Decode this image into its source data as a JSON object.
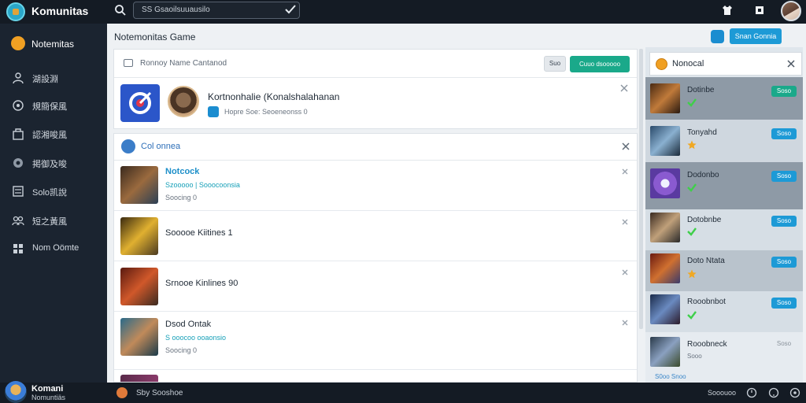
{
  "topbar": {
    "app_title": "Komunitas",
    "search_text": "SS Gsaoilsuuausilo"
  },
  "sidebar": {
    "header_label": "Notemitas",
    "items": [
      {
        "label": "湖設淵",
        "icon": "person-icon"
      },
      {
        "label": "規簡保風",
        "icon": "settings-icon"
      },
      {
        "label": "認湘唆風",
        "icon": "bag-icon"
      },
      {
        "label": "掲御及唆",
        "icon": "chat-icon"
      },
      {
        "label": "Solo凯說",
        "icon": "list-icon"
      },
      {
        "label": "短之黃風",
        "icon": "group-icon"
      },
      {
        "label": "Nom Oömte",
        "icon": "grid-icon"
      }
    ]
  },
  "main": {
    "title": "Notemonitas Game",
    "blue_button": "Snan Gonnia"
  },
  "panel1": {
    "prompt": "Ronnoy  Name Cantanod",
    "small_button": "Suo",
    "green_button": "Cuuo dsooooo",
    "name": "Kortnonhalie (Konalshalahanan",
    "sub": "Hopre Soe:    Seoeneonss    0"
  },
  "panel2": {
    "header": "Col onnea",
    "rows": [
      {
        "title": "Notcock",
        "meta1": "Szooooo  | Sooocoonsia",
        "meta2": "Soocing    0"
      },
      {
        "title": "Sooooe Kiitines  1",
        "meta1": "",
        "meta2": ""
      },
      {
        "title": "Srnooe Kinlines  90",
        "meta1": "",
        "meta2": ""
      },
      {
        "title": "Dsod Ontak",
        "meta1": "S ooocoo  ooaonsio",
        "meta2": "Soocing    0"
      }
    ]
  },
  "rpanel": {
    "header": "Nonocal",
    "rows": [
      {
        "name": "Dotinbe",
        "badge": "Soso",
        "badge_color": "#1aa98a",
        "mark": "check"
      },
      {
        "name": "Tonyahd",
        "badge": "Soso",
        "badge_color": "#1d9ad6",
        "mark": "star"
      },
      {
        "name": "Dodonbo",
        "badge": "Soso",
        "badge_color": "#1d9ad6",
        "mark": "check"
      },
      {
        "name": "Dotobnbe",
        "badge": "Soso",
        "badge_color": "#1d9ad6",
        "mark": "check"
      },
      {
        "name": "Doto Ntata",
        "badge": "Soso",
        "badge_color": "#1d9ad6",
        "mark": "star"
      },
      {
        "name": "Rooobnbot",
        "badge": "Soso",
        "badge_color": "#1d9ad6",
        "mark": "check"
      },
      {
        "name": "Rooobneck",
        "badge": "Soso",
        "badge_color": "#8a939c",
        "mark": "text",
        "sub": "Sooo"
      }
    ],
    "more": "S0oo Snoo"
  },
  "bottombar": {
    "user_name": "Komani",
    "user_sub": "Nomuntiäs",
    "status": "Sby Sooshoe",
    "right_text": "Sooouoo"
  },
  "colors": {
    "topbar": "#141b24",
    "sidebar": "#1b2430",
    "accent_green": "#1aa98a",
    "accent_blue": "#1d9ad6"
  }
}
